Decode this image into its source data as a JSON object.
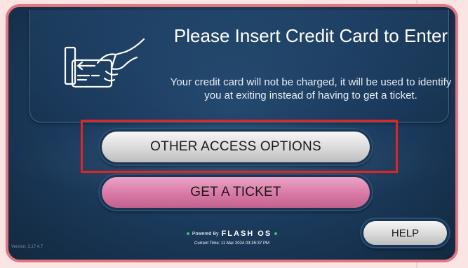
{
  "prompt": {
    "title": "Please Insert Credit Card to Enter",
    "subtitle": "Your credit card will not be charged, it will be used to identify you at exiting instead of having to get a ticket."
  },
  "buttons": {
    "other_access": "OTHER ACCESS OPTIONS",
    "get_ticket": "GET A TICKET",
    "help": "HELP"
  },
  "footer": {
    "powered_by": "Powered By",
    "brand": "FLASH OS",
    "current_time": "Current Time: 11 Mar 2024 03:35:37 PM",
    "version": "Version: 3.17.4.7"
  },
  "icons": {
    "card_insert": "hand-inserting-credit-card-icon",
    "status_dot": "status-dot-icon"
  },
  "colors": {
    "frame_border": "#e3757f",
    "highlight_box": "#e02424",
    "ticket_button": "#d978a5",
    "background": "#1b3a5c"
  }
}
